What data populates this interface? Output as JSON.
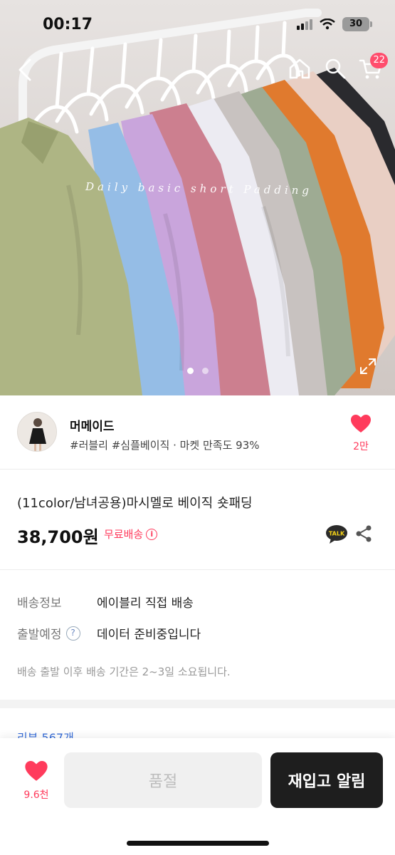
{
  "status_bar": {
    "time": "00:17",
    "battery": "30"
  },
  "nav": {
    "cart_badge": "22"
  },
  "hero": {
    "overlay_text": "Daily basic short Padding",
    "slide_count": 2,
    "active_slide": 1
  },
  "seller": {
    "name": "머메이드",
    "tags": "#러블리 #심플베이직 · 마켓 만족도 93%",
    "like_count": "2만"
  },
  "product": {
    "title": "(11color/남녀공용)마시멜로 베이직 숏패딩",
    "price": "38,700원",
    "free_shipping": "무료배송",
    "talk_label": "TALK"
  },
  "delivery": {
    "shipping_label": "배송정보",
    "shipping_value": "에이블리 직접 배송",
    "depart_label": "출발예정",
    "depart_value": "데이터 준비중입니다",
    "note": "배송 출발 이후 배송 기간은 2~3일 소요됩니다."
  },
  "reviews": {
    "link": "리뷰 567개"
  },
  "bottom_bar": {
    "wish_count": "9.6천",
    "soldout_label": "품절",
    "restock_label": "재입고 알림"
  },
  "colors": {
    "accent": "#ff3b5c",
    "dark_button": "#1e1e1e",
    "link": "#3a6fd8"
  },
  "icons": [
    "back-icon",
    "home-icon",
    "search-icon",
    "cart-icon",
    "expand-icon",
    "heart-icon",
    "info-icon",
    "kakao-talk-icon",
    "share-icon",
    "question-icon"
  ]
}
